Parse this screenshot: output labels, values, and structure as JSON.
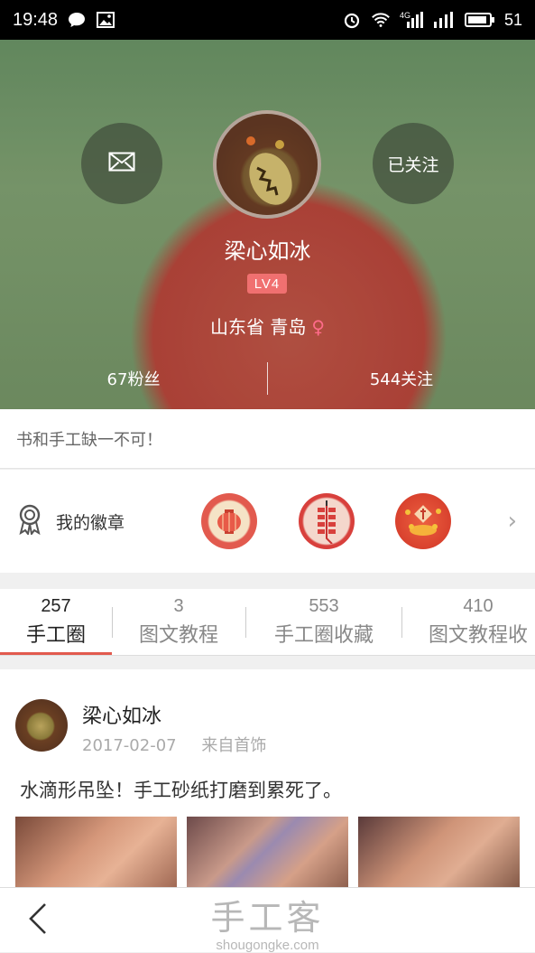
{
  "status_bar": {
    "time": "19:48",
    "battery": "51",
    "network": "4G",
    "icons": [
      "chat-bubble-icon",
      "image-icon",
      "alarm-icon",
      "wifi-icon",
      "signal-icon",
      "battery-icon"
    ]
  },
  "profile": {
    "message_icon": "envelope-icon",
    "follow_label": "已关注",
    "username": "梁心如冰",
    "level": "LV4",
    "location": "山东省 青岛",
    "gender_symbol": "♀",
    "followers": "67粉丝",
    "following": "544关注"
  },
  "bio": "书和手工缺一不可！",
  "badges": {
    "label": "我的徽章",
    "icon": "medal-icon",
    "items": [
      "lantern-badge",
      "firecracker-badge",
      "fu-badge"
    ],
    "arrow": "›"
  },
  "tabs": [
    {
      "count": "257",
      "label": "手工圈",
      "active": true
    },
    {
      "count": "3",
      "label": "图文教程",
      "active": false
    },
    {
      "count": "553",
      "label": "手工圈收藏",
      "active": false
    },
    {
      "count": "410",
      "label": "图文教程收",
      "active": false
    }
  ],
  "post": {
    "author": "梁心如冰",
    "date": "2017-02-07",
    "source": "来自首饰",
    "text": "水滴形吊坠！手工砂纸打磨到累死了。"
  },
  "bottom_bar": {
    "watermark_cn": "手工客",
    "watermark_en": "shougongke.com"
  },
  "colors": {
    "accent": "#e25a4e",
    "level_badge": "#f07070",
    "gender": "#ff6b8a"
  }
}
